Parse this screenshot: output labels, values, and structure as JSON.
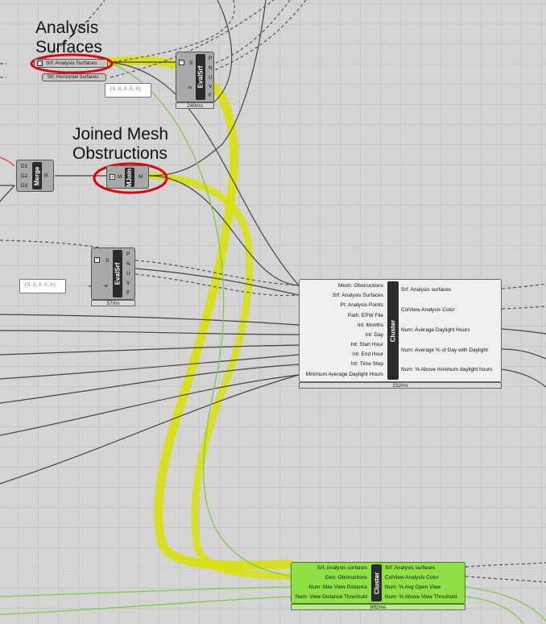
{
  "annotations": {
    "analysis_surfaces": "Analysis\nSurfaces",
    "joined_mesh": "Joined Mesh\nObstructions"
  },
  "params": {
    "analysis_surfaces": "Srf: Analysis Surfaces",
    "horizontal_surfaces": "Srf: Horizontal Surfaces"
  },
  "panels": {
    "panel_top": "{0.5,0.5,0}",
    "panel_mid": "{0.5,0.5,0}"
  },
  "evalsrf_top": {
    "name": "EvalSrf",
    "inputs": [
      "S",
      "uv"
    ],
    "outputs": [
      "P",
      "N",
      "U",
      "V",
      "F"
    ],
    "time": "240ms"
  },
  "evalsrf_mid": {
    "name": "EvalSrf",
    "inputs": [
      "S",
      "uv"
    ],
    "outputs": [
      "P",
      "N",
      "U",
      "V",
      "F"
    ],
    "time": "57ms"
  },
  "merge": {
    "name": "Merge",
    "inputs": [
      "D1",
      "D2",
      "D3"
    ],
    "outputs": [
      "R"
    ]
  },
  "mjoin": {
    "name": "MJoin",
    "inputs": [
      "M"
    ],
    "outputs": [
      "M"
    ]
  },
  "cluster_daylight": {
    "name": "Cluster",
    "inputs": [
      "Mesh: Obstructions",
      "Srf: Analysis Surfaces",
      "Pt: Analysis Points",
      "Path: EPW File",
      "Int: Months",
      "Int: Day",
      "Int: Start Hour",
      "Int: End Hour",
      "Int: Time Step",
      "Minimum Average Daylight Hours"
    ],
    "outputs": [
      "Srf: Analysis surfaces",
      "ColView Analysis Color",
      "Num: Average Daylight Hours",
      "Num: Average % of Day with Daylight",
      "Num: % Above minimum daylight hours"
    ],
    "time": "232ms"
  },
  "cluster_view": {
    "name": "Cluster",
    "inputs": [
      "Srf: Analysis surfaces",
      "Geo: Obstructions",
      "Num: Max View Distance",
      "Num: View Distance Threshold"
    ],
    "outputs": [
      "Srf: Analysis surfaces",
      "ColView Analysis Color",
      "Num: % Avg Open View",
      "Num: % Above View Threshold"
    ],
    "time": "892ms"
  },
  "colors": {
    "canvas": "#d4d4d4",
    "component": "#a9a9ac",
    "cluster_green": "#8fe045",
    "highlight_yellow": "#d8e100",
    "annotation_red": "#e0000b",
    "wire_green": "#7ccc4a"
  }
}
